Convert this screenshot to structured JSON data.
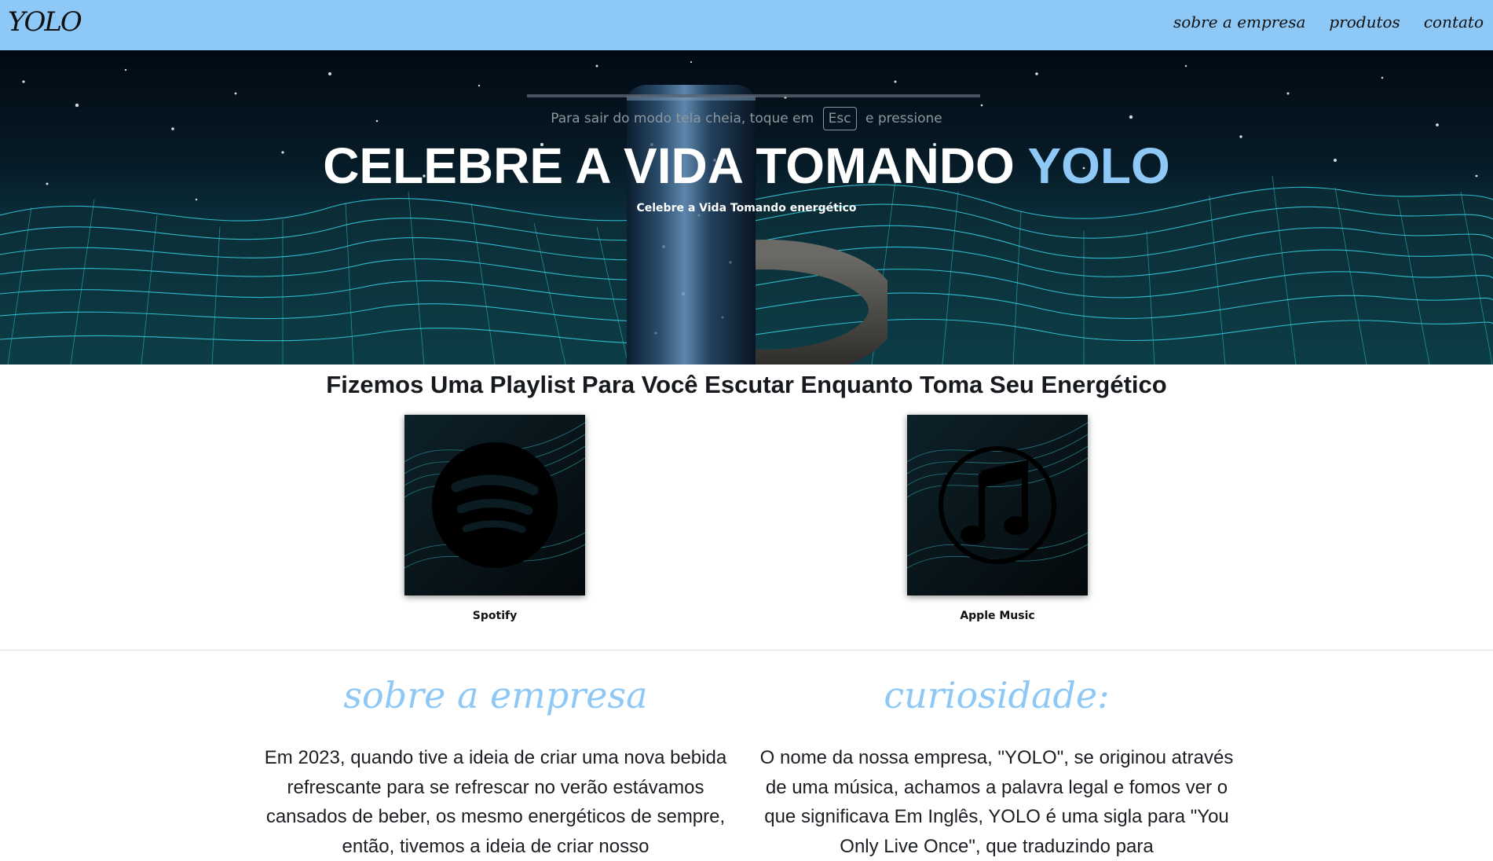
{
  "header": {
    "logo": "YOLO",
    "nav": [
      "sobre a empresa",
      "produtos",
      "contato"
    ]
  },
  "hero": {
    "fullscreen_note": {
      "before": "Para sair do modo tela cheia, toque em",
      "key": "Esc",
      "after": "e pressione"
    },
    "title_main": "CELEBRE A VIDA TOMANDO ",
    "title_accent": "YOLO",
    "subtitle": "Celebre a Vida Tomando energético"
  },
  "playlist": {
    "title": "Fizemos Uma Playlist Para Você Escutar Enquanto Toma Seu Energético",
    "cards": [
      {
        "label": "Spotify",
        "icon": "spotify-icon"
      },
      {
        "label": "Apple Music",
        "icon": "music-note-icon"
      }
    ]
  },
  "sections": [
    {
      "title": "sobre a empresa",
      "text": "Em 2023, quando tive a ideia de criar uma nova bebida refrescante para se refrescar no verão estávamos cansados de beber, os mesmo energéticos de sempre, então, tivemos a ideia de criar nosso"
    },
    {
      "title": "curiosidade:",
      "text": "O nome da nossa empresa, \"YOLO\", se originou através de uma música, achamos a palavra legal e fomos ver o que significava Em Inglês, YOLO é uma sigla para \"You Only Live Once\", que traduzindo para"
    }
  ],
  "colors": {
    "header_bg": "#8ec8f6",
    "accent": "#8ec8f6",
    "hero_bg": "#061a26",
    "grid": "#35d3e6"
  }
}
